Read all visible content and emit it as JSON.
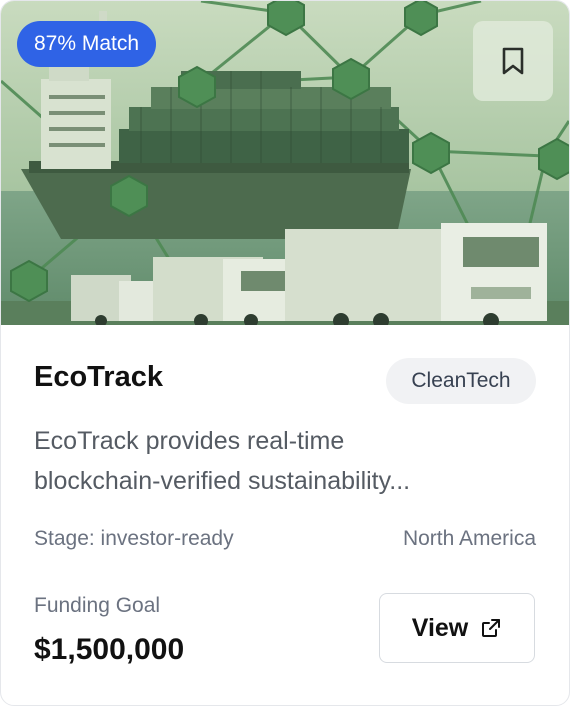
{
  "card": {
    "match_badge": "87% Match",
    "title": "EcoTrack",
    "category": "CleanTech",
    "description_lines": [
      "EcoTrack provides real-time",
      "blockchain-verified sustainability..."
    ],
    "stage": "Stage: investor-ready",
    "region": "North America",
    "funding_label": "Funding Goal",
    "funding_value": "$1,500,000",
    "view_label": "View"
  },
  "icons": {
    "bookmark": "bookmark-icon",
    "external_link": "external-link-icon"
  },
  "colors": {
    "badge_bg": "#2f63e6",
    "hero_tint": "#6f9a6a",
    "category_bg": "#f1f2f4"
  }
}
